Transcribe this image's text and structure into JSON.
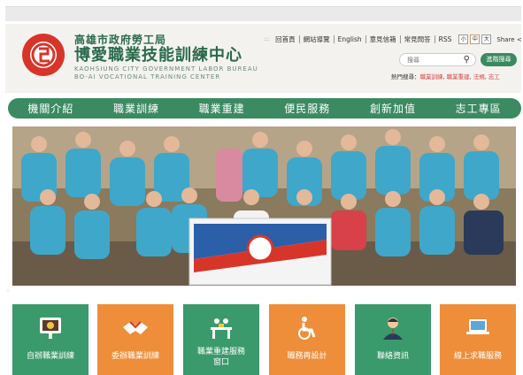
{
  "header": {
    "title_line1": "高雄市政府勞工局",
    "title_line2": "博愛職業技能訓練中心",
    "en_line1": "KAOHSIUNG CITY GOVERNMENT LABOR BUREAU",
    "en_line2": "BO-AI VOCATIONAL TRAINING CENTER"
  },
  "top_links": [
    "回首頁",
    "網站導覽",
    "English",
    "意見信箱",
    "常見問答",
    "RSS"
  ],
  "font_sizes": [
    "小",
    "中",
    "大"
  ],
  "share_label": "Share",
  "search": {
    "placeholder": "搜尋",
    "button": "進階搜尋"
  },
  "hot_search": {
    "label": "熱門搜尋：",
    "items": [
      "職業訓練",
      "職業重建",
      "法規",
      "志工"
    ]
  },
  "main_nav": [
    "機關介紹",
    "職業訓練",
    "職業重建",
    "便民服務",
    "創新加值",
    "志工專區"
  ],
  "banner": {
    "flag_text": "天使之賀志工隊"
  },
  "tiles": [
    {
      "line1": "自辦職業訓練",
      "line2": "",
      "icon": "presentation-icon",
      "color": "#3a9a6b"
    },
    {
      "line1": "委辦職業訓練",
      "line2": "",
      "icon": "handshake-icon",
      "color": "#ee8e3a"
    },
    {
      "line1": "職業重建服務",
      "line2": "窗口",
      "icon": "counter-service-icon",
      "color": "#3a9a6b"
    },
    {
      "line1": "職務再設計",
      "line2": "",
      "icon": "wheelchair-icon",
      "color": "#ee8e3a"
    },
    {
      "line1": "聯絡資訊",
      "line2": "",
      "icon": "contact-person-icon",
      "color": "#3a9a6b"
    },
    {
      "line1": "線上求職服務",
      "line2": "",
      "icon": "laptop-icon",
      "color": "#ee8e3a"
    }
  ]
}
